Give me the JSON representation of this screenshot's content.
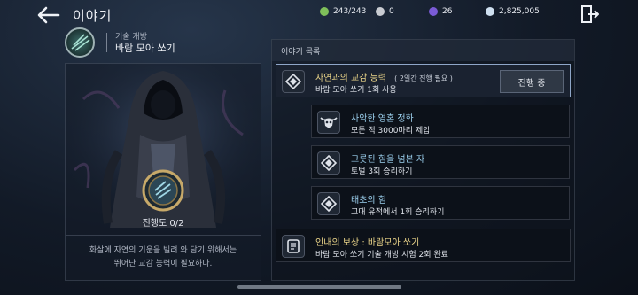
{
  "header": {
    "title": "이야기"
  },
  "resources": [
    {
      "value": "243/243",
      "icon": "stamina-icon",
      "color": "#7fbf5a"
    },
    {
      "value": "0",
      "icon": "silver-coin-icon",
      "color": "#c9ccd2"
    },
    {
      "value": "26",
      "icon": "purple-gem-icon",
      "color": "#7a5bd6"
    },
    {
      "value": "2,825,005",
      "icon": "crystal-coin-icon",
      "color": "#cfe0f0"
    }
  ],
  "skill": {
    "category": "기술 개방",
    "name": "바람 모아 쏘기"
  },
  "left": {
    "progress_text": "진행도 0/2",
    "desc_line1": "화살에 자연의 기운을 빌려 와 담기 위해서는",
    "desc_line2": "뛰어난 교감 능력이 필요하다."
  },
  "list": {
    "title": "이야기 목록",
    "main": {
      "title": "자연과의 교감 능력",
      "note": "( 2일간 진행 필요 )",
      "subtitle": "바람 모아 쏘기 1회 사용",
      "button": "진행 중"
    },
    "tasks": [
      {
        "title": "사악한 영혼 정화",
        "subtitle": "모든 적 3000마리 제압",
        "icon": "skull-horns-icon"
      },
      {
        "title": "그릇된 힘을 넘본 자",
        "subtitle": "토벌 3회 승리하기",
        "icon": "diamond-icon"
      },
      {
        "title": "태초의 힘",
        "subtitle": "고대 유적에서 1회 승리하기",
        "icon": "diamond-icon"
      }
    ],
    "reward": {
      "title": "인내의 보상 : 바람모아 쏘기",
      "subtitle": "바람 모아 쏘기 기술 개방 시험 2회 완료",
      "icon": "scroll-icon"
    }
  },
  "colors": {
    "accent_gold": "#ecd68a",
    "task_blue": "#9cd0ee",
    "active_border": "#8fa6c8"
  }
}
